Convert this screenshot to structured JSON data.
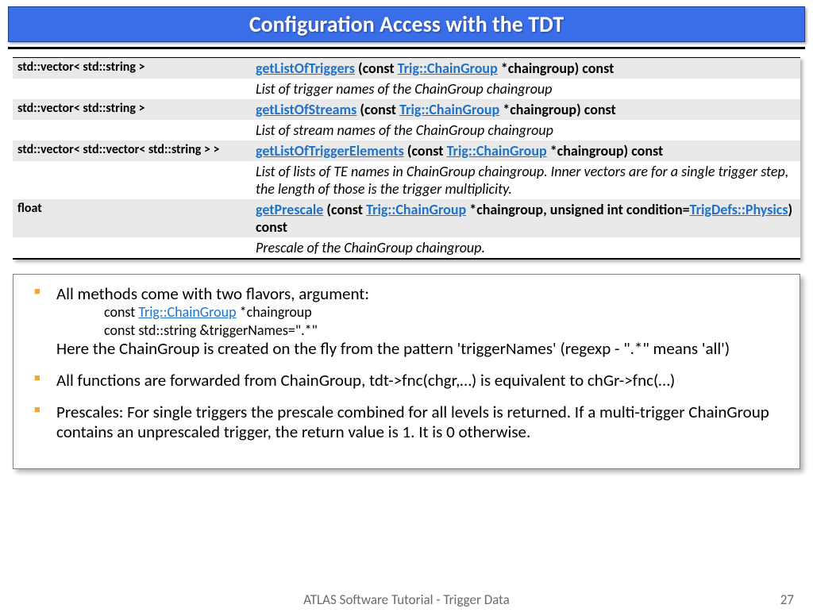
{
  "title": "Configuration Access with the TDT",
  "api": [
    {
      "ret": "std::vector< std::string >",
      "fn": "getListOfTriggers",
      "sig_pre": " (const ",
      "link": "Trig::ChainGroup",
      "sig_post": " *chaingroup) const",
      "desc": "List of trigger names of the ChainGroup chaingroup"
    },
    {
      "ret": "std::vector< std::string >",
      "fn": "getListOfStreams",
      "sig_pre": " (const ",
      "link": "Trig::ChainGroup",
      "sig_post": " *chaingroup) const",
      "desc": "List of stream names of the ChainGroup chaingroup"
    },
    {
      "ret": "std::vector< std::vector< std::string > >",
      "fn": "getListOfTriggerElements",
      "sig_pre": " (const ",
      "link": "Trig::ChainGroup",
      "sig_post": " *chaingroup) const",
      "desc": "List of lists of TE names in ChainGroup chaingroup. Inner vectors are for a single trigger step, the length of those is the trigger multiplicity."
    },
    {
      "ret": "float",
      "fn": "getPrescale",
      "sig_pre": " (const ",
      "link": "Trig::ChainGroup",
      "sig_mid": " *chaingroup, unsigned int condition=",
      "link2": "TrigDefs::Physics",
      "sig_post": ") const",
      "desc": "Prescale of the ChainGroup chaingroup."
    }
  ],
  "bullets": {
    "b1": "All methods come with two flavors, argument:",
    "b1_code1_pre": "const ",
    "b1_code1_link": "Trig::ChainGroup",
    "b1_code1_post": " *chaingroup",
    "b1_code2": "const std::string &triggerNames=\".*\"",
    "b1_tail": "Here the ChainGroup is created on the fly from the pattern 'triggerNames' (regexp - \".*\" means 'all')",
    "b2": "All functions are forwarded from ChainGroup, tdt->fnc(chgr,…) is equivalent to chGr->fnc(…)",
    "b3": "Prescales: For single triggers the prescale combined for all levels is returned. If a multi-trigger  ChainGroup contains an unprescaled trigger, the return value is  1. It is 0 otherwise."
  },
  "footer": "ATLAS Software Tutorial - Trigger Data",
  "page": "27"
}
